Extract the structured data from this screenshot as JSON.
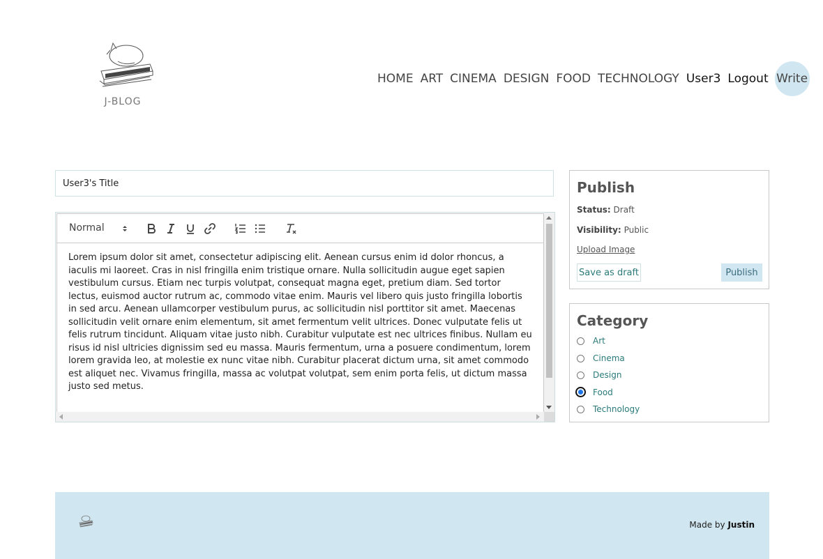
{
  "logo": {
    "text": "J-BLOG"
  },
  "nav": {
    "links": [
      "HOME",
      "ART",
      "CINEMA",
      "DESIGN",
      "FOOD",
      "TECHNOLOGY"
    ],
    "user": "User3",
    "logout": "Logout",
    "write": "Write"
  },
  "editor": {
    "title_value": "User3's Title",
    "format_select": "Normal",
    "body": "Lorem ipsum dolor sit amet, consectetur adipiscing elit. Aenean cursus enim id dolor rhoncus, a iaculis mi laoreet. Cras in nisl fringilla enim tristique ornare. Nulla sollicitudin augue eget sapien vestibulum cursus. Etiam nec turpis volutpat, consequat magna eget, pretium diam. Sed tortor lectus, euismod auctor rutrum ac, commodo vitae enim. Mauris vel libero quis justo fringilla lobortis in sed arcu. Aenean ullamcorper vestibulum purus, ac sollicitudin nisl porttitor sit amet. Maecenas sollicitudin velit ornare enim elementum, sit amet fermentum velit ultrices. Donec vulputate felis ut felis rutrum tincidunt. Aliquam vitae justo nibh. Curabitur vulputate est nec ultrices finibus. Nullam eu risus id nisl ultricies dignissim sed eu massa. Mauris fermentum, urna a posuere condimentum, lorem lorem gravida leo, at molestie ex nunc vitae nibh. Curabitur placerat dictum urna, sit amet commodo est aliquet nec. Vivamus fringilla, massa ac volutpat volutpat, sem enim porta felis, ut dictum massa justo sed metus.",
    "toolbar_icons": [
      "bold-icon",
      "italic-icon",
      "underline-icon",
      "link-icon",
      "ordered-list-icon",
      "bullet-list-icon",
      "clear-format-icon"
    ]
  },
  "publish": {
    "title": "Publish",
    "status_label": "Status:",
    "status_value": "Draft",
    "visibility_label": "Visibility:",
    "visibility_value": "Public",
    "upload": "Upload Image",
    "save_draft": "Save as draft",
    "publish_button": "Publish"
  },
  "category": {
    "title": "Category",
    "options": [
      "Art",
      "Cinema",
      "Design",
      "Food",
      "Technology"
    ],
    "selected": "Food"
  },
  "footer": {
    "made_by": "Made by",
    "author": "Justin"
  }
}
